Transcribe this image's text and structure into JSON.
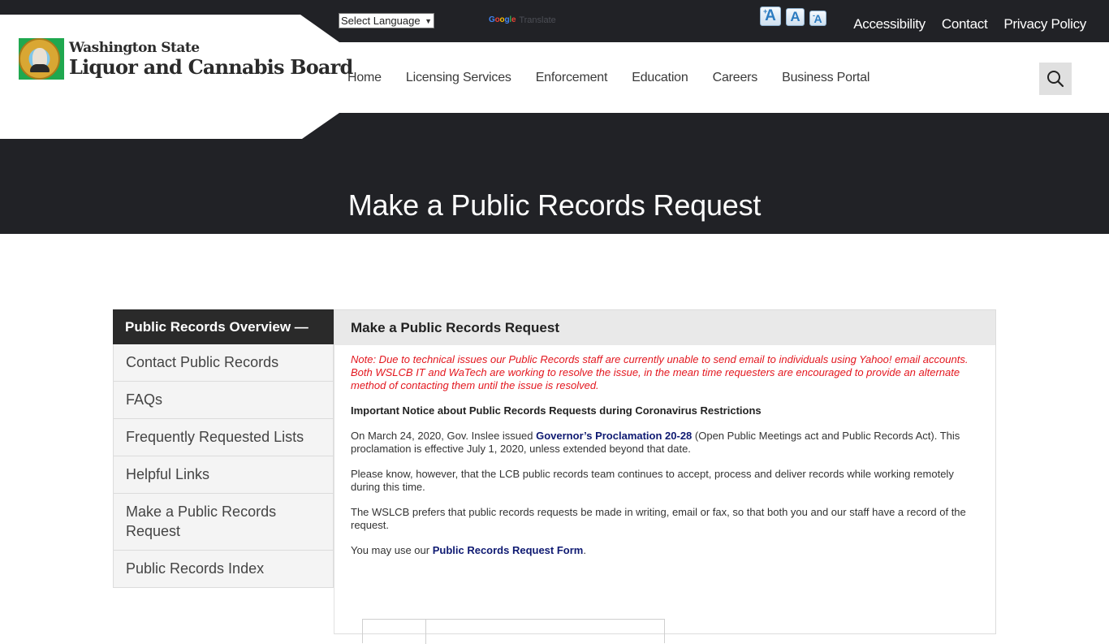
{
  "topbar": {
    "language_select": {
      "value": "Select Language"
    },
    "google_translate": {
      "brand": [
        "G",
        "o",
        "o",
        "g",
        "l",
        "e"
      ],
      "label": "Translate"
    },
    "font_size_buttons": [
      {
        "name": "increase",
        "glyph": "A",
        "prefix": "+"
      },
      {
        "name": "reset",
        "glyph": "A",
        "prefix": ""
      },
      {
        "name": "decrease",
        "glyph": "A",
        "prefix": "-"
      }
    ],
    "links": [
      "Accessibility",
      "Contact",
      "Privacy Policy"
    ]
  },
  "logo": {
    "line1": "Washington State",
    "line2": "Liquor and Cannabis Board"
  },
  "nav": {
    "items": [
      "Home",
      "Licensing Services",
      "Enforcement",
      "Education",
      "Careers",
      "Business Portal"
    ],
    "search_icon": "search-icon"
  },
  "hero": {
    "title": "Make a Public Records Request"
  },
  "sidebar": {
    "header": "Public Records Overview —",
    "items": [
      "Contact Public Records",
      "FAQs",
      "Frequently Requested Lists",
      "Helpful Links",
      "Make a Public Records Request",
      "Public Records Index"
    ]
  },
  "content": {
    "title": "Make a Public Records Request",
    "note": "Note: Due to technical issues our Public Records staff are currently unable to send email to individuals using Yahoo! email accounts. Both WSLCB IT and WaTech are working to resolve the issue, in the mean time requesters are encouraged to provide an alternate method of contacting them until the issue is resolved.",
    "notice_heading": "Important Notice about Public Records Requests during Coronavirus Restrictions",
    "p1_before": "On March 24, 2020, Gov. Inslee issued ",
    "p1_link": "Governor’s Proclamation 20-28",
    "p1_after": " (Open Public Meetings act and Public Records Act). This proclamation is effective July 1, 2020, unless extended beyond that date.",
    "p2": "Please know, however, that the LCB public records team continues to accept, process and deliver records while working remotely during this time.",
    "p3": "The WSLCB prefers that public records requests be made in writing, email or fax, so that both you and our staff have a record of the request.",
    "p4_before": "You may use our ",
    "p4_link": "Public Records Request Form",
    "p4_after": "."
  },
  "colors": {
    "dark_bar": "#212226",
    "note_red": "#e3171f",
    "link_navy": "#0f1a72",
    "sidebar_header": "#2a2a2a",
    "seal_green": "#1fa84f"
  }
}
